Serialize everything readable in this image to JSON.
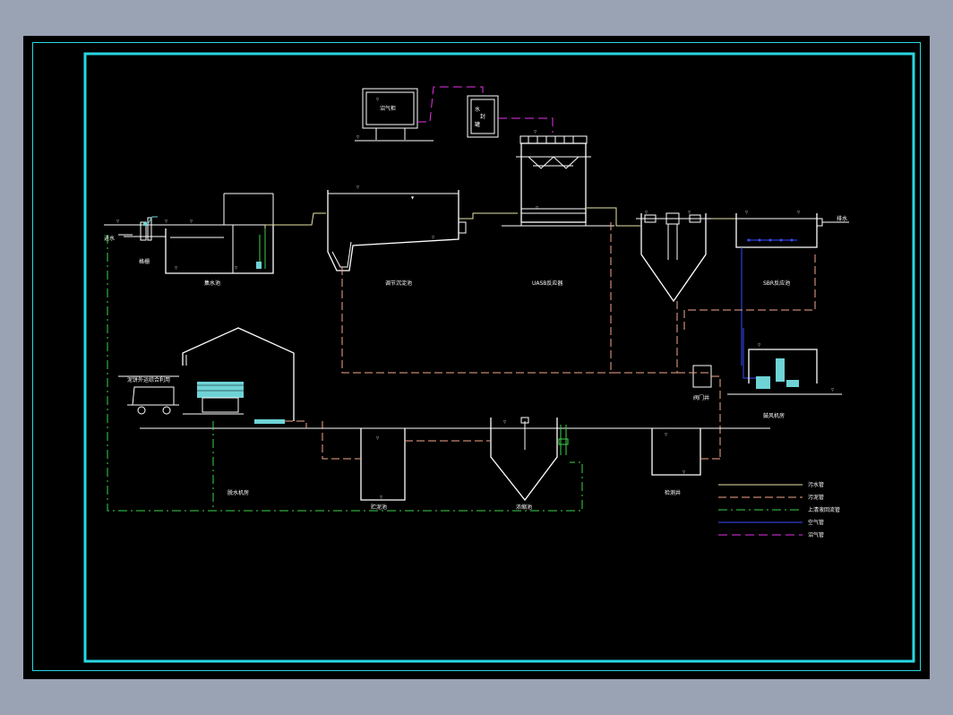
{
  "labels": {
    "biogas_cabinet": "沼气柜",
    "water_seal": "水",
    "water_seal_2": "封",
    "water_seal_3": "罐",
    "inlet": "进水",
    "screen": "格栅",
    "collection_tank": "集水池",
    "regulating_tank": "调节沉淀池",
    "uasb": "UASB反应器",
    "sbr": "SBR反应池",
    "outlet": "排水",
    "fan_room": "鼓风机房",
    "valve_well": "阀门井",
    "sludge_transport": "泥饼外运综合利用",
    "dewatering_room": "脱水机房",
    "storage_tank": "贮泥池",
    "thickener": "浓缩池",
    "inspection_well": "检测井"
  },
  "legend": [
    {
      "label": "污水管",
      "kind": "sewage"
    },
    {
      "label": "污泥管",
      "kind": "sludge"
    },
    {
      "label": "上清液回流管",
      "kind": "super"
    },
    {
      "label": "空气管",
      "kind": "air"
    },
    {
      "label": "沼气管",
      "kind": "biogas"
    }
  ],
  "colors": {
    "frame": "#27d7e2",
    "sewage": "#e8e4a8",
    "sludge": "#f4a78c",
    "supernatant": "#3ad34a",
    "air": "#3a4dff",
    "biogas": "#e832e8",
    "equipment": "#6fd3d6"
  }
}
